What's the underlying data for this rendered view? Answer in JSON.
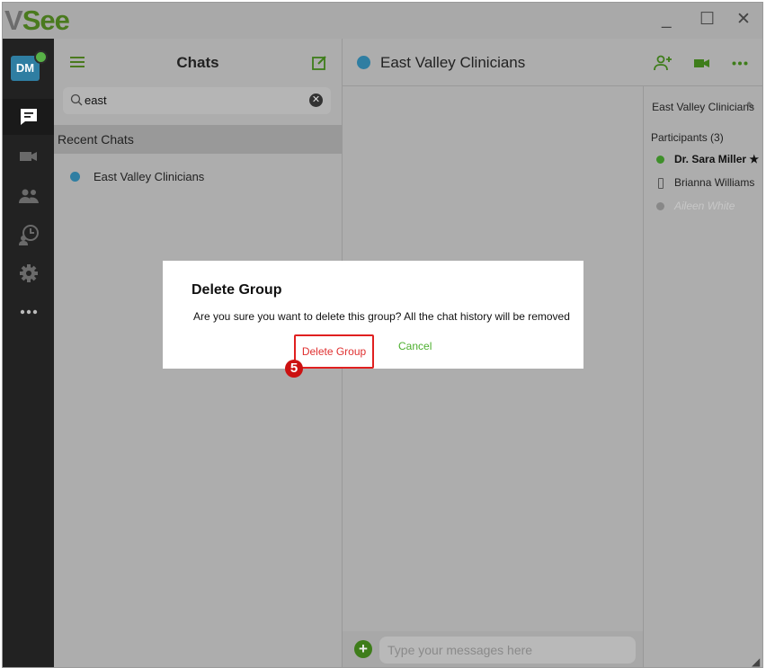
{
  "app": {
    "logo_v": "V",
    "logo_see": "See"
  },
  "window_controls": {
    "minimize": "_",
    "maximize": "☐",
    "close": "✕"
  },
  "user": {
    "initials": "DM",
    "status_color": "#58b147"
  },
  "chats_panel": {
    "title": "Chats",
    "search": {
      "value": "east"
    },
    "section_header": "Recent Chats",
    "items": [
      {
        "name": "East Valley Clinicians"
      }
    ]
  },
  "conversation": {
    "title": "East Valley Clinicians",
    "composer_placeholder": "Type your messages here"
  },
  "details_panel": {
    "group_name": "East Valley Clinicians",
    "participants_label": "Participants (3)",
    "participants": [
      {
        "name": "Dr. Sara Miller ★",
        "status_color": "#3e8f2a",
        "style": "bold"
      },
      {
        "name": "Brianna Williams",
        "status_color": "#555555",
        "style": "normal"
      },
      {
        "name": "Aileen White",
        "status_color": "#888888",
        "style": "offline"
      }
    ]
  },
  "dialog": {
    "title": "Delete Group",
    "message": "Are you sure you want to delete this group? All the chat history will be removed",
    "confirm_label": "Delete Group",
    "cancel_label": "Cancel"
  },
  "annotation": {
    "step_marker": "5"
  },
  "colors": {
    "brand_green": "#4a7a1e",
    "accent_blue": "#2f7ea2",
    "danger": "#e02020",
    "ok_green": "#4caf2e"
  }
}
